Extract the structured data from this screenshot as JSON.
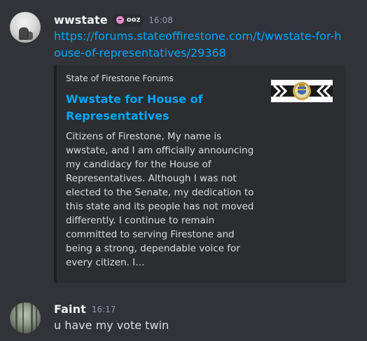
{
  "messages": [
    {
      "username": "wwstate",
      "tag": "ooz",
      "tag_icon": "pink-skull-icon",
      "time": "16:08",
      "link": "https://forums.stateoffirestone.com/t/wwstate-for-house-of-representatives/29368",
      "embed": {
        "provider": "State of Firestone Forums",
        "title": "Wwstate for House of Representatives",
        "description": "Citizens of Firestone, My name is wwstate, and I am officially announcing my candidacy for the House of Representatives. Although I was not elected to the Senate, my dedication to this state and its people has not moved differently. I continue to remain committed to serving Firestone and being a strong, dependable voice for every citizen. I…",
        "thumbnail_icon": "state-flag-seal-icon"
      }
    },
    {
      "username": "Faint",
      "time": "16:17",
      "text": "u have my vote twin"
    }
  ],
  "colors": {
    "background": "#313338",
    "embed_background": "#2b2d31",
    "link": "#00a8fc",
    "username": "#f2f3f5",
    "timestamp": "#949ba4",
    "text": "#dbdee1"
  }
}
